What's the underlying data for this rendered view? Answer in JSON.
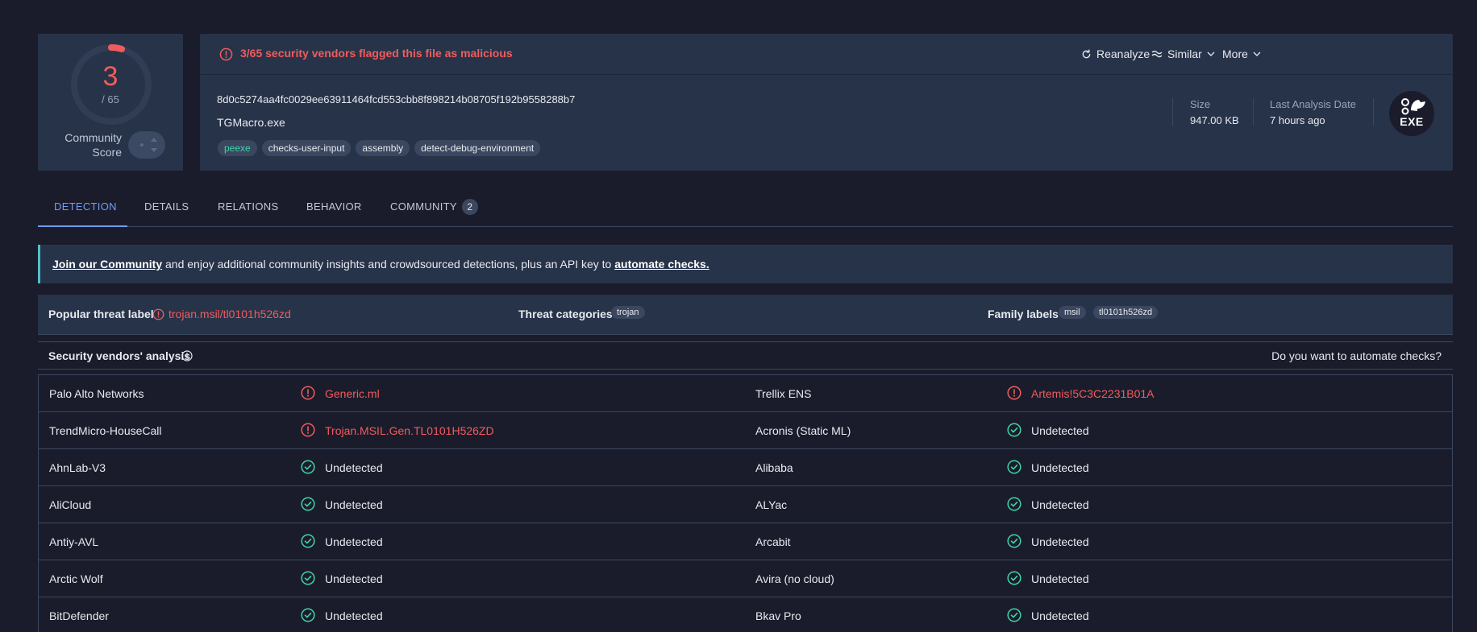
{
  "score": {
    "detections": "3",
    "total": "/ 65",
    "detection_fraction": 0.046,
    "community_label": "Community Score"
  },
  "file": {
    "alert": "3/65 security vendors flagged this file as malicious",
    "hash": "8d0c5274aa4fc0029ee63911464fcd553cbb8f898214b08705f192b9558288b7",
    "name": "TGMacro.exe",
    "tags": [
      "peexe",
      "checks-user-input",
      "assembly",
      "detect-debug-environment"
    ],
    "size_label": "Size",
    "size_value": "947.00 KB",
    "date_label": "Last Analysis Date",
    "date_value": "7 hours ago",
    "badge": "EXE",
    "actions": {
      "reanalyze": "Reanalyze",
      "similar": "Similar",
      "more": "More"
    }
  },
  "tabs": [
    {
      "label": "DETECTION"
    },
    {
      "label": "DETAILS"
    },
    {
      "label": "RELATIONS"
    },
    {
      "label": "BEHAVIOR"
    },
    {
      "label": "COMMUNITY",
      "count": "2"
    }
  ],
  "banner": {
    "link1": "Join our Community",
    "middle": " and enjoy additional community insights and crowdsourced detections, plus an API key to ",
    "link2": "automate checks."
  },
  "threat": {
    "popular_label": "Popular threat label",
    "popular_value": "trojan.msil/tl0101h526zd",
    "categories_label": "Threat categories",
    "categories": [
      "trojan"
    ],
    "family_label": "Family labels",
    "families": [
      "msil",
      "tl0101h526zd"
    ]
  },
  "vendors": {
    "title": "Security vendors' analysis",
    "automate_question": "Do you want to automate checks?",
    "rows": [
      {
        "left": {
          "name": "Palo Alto Networks",
          "result": "Generic.ml",
          "malicious": true
        },
        "right": {
          "name": "Trellix ENS",
          "result": "Artemis!5C3C2231B01A",
          "malicious": true
        }
      },
      {
        "left": {
          "name": "TrendMicro-HouseCall",
          "result": "Trojan.MSIL.Gen.TL0101H526ZD",
          "malicious": true
        },
        "right": {
          "name": "Acronis (Static ML)",
          "result": "Undetected",
          "malicious": false
        }
      },
      {
        "left": {
          "name": "AhnLab-V3",
          "result": "Undetected",
          "malicious": false
        },
        "right": {
          "name": "Alibaba",
          "result": "Undetected",
          "malicious": false
        }
      },
      {
        "left": {
          "name": "AliCloud",
          "result": "Undetected",
          "malicious": false
        },
        "right": {
          "name": "ALYac",
          "result": "Undetected",
          "malicious": false
        }
      },
      {
        "left": {
          "name": "Antiy-AVL",
          "result": "Undetected",
          "malicious": false
        },
        "right": {
          "name": "Arcabit",
          "result": "Undetected",
          "malicious": false
        }
      },
      {
        "left": {
          "name": "Arctic Wolf",
          "result": "Undetected",
          "malicious": false
        },
        "right": {
          "name": "Avira (no cloud)",
          "result": "Undetected",
          "malicious": false
        }
      },
      {
        "left": {
          "name": "BitDefender",
          "result": "Undetected",
          "malicious": false
        },
        "right": {
          "name": "Bkav Pro",
          "result": "Undetected",
          "malicious": false
        }
      }
    ]
  },
  "colors": {
    "background": "#1b1c2b",
    "panel": "#273349",
    "malicious": "#f05c5c",
    "clean": "#3fd5a8",
    "accent": "#6e9df7",
    "banner_accent": "#4ec1ca"
  }
}
